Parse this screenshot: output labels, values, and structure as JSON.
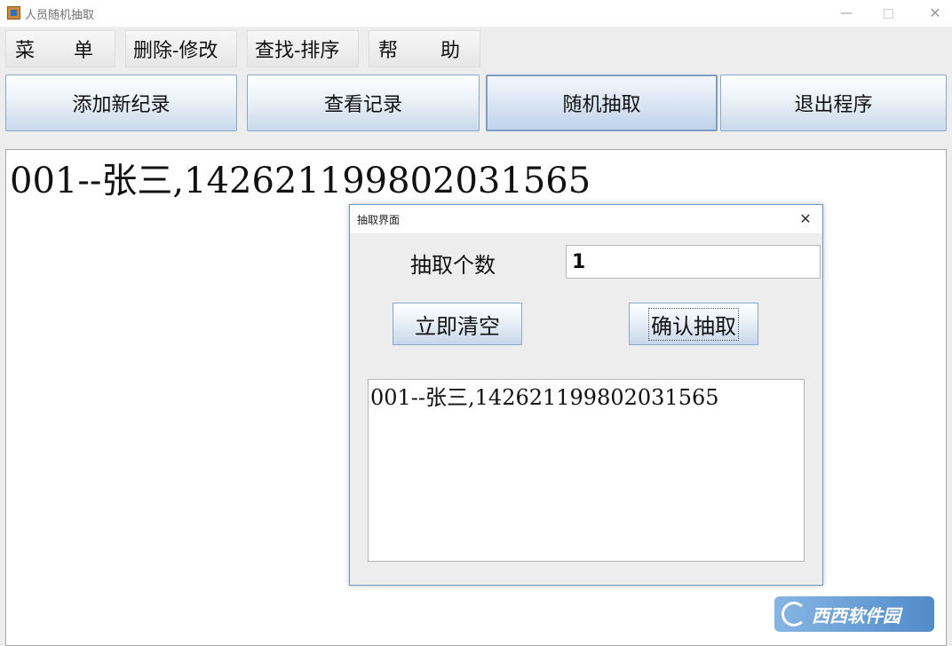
{
  "window": {
    "title": "人员随机抽取",
    "minimize": "—",
    "close": "✕"
  },
  "menu": {
    "items": [
      {
        "chars": [
          "菜",
          "单"
        ]
      },
      {
        "label": "删除-修改"
      },
      {
        "label": "查找-排序"
      },
      {
        "chars": [
          "帮",
          "助"
        ]
      }
    ]
  },
  "toolbar": {
    "add": "添加新纪录",
    "view": "查看记录",
    "random": "随机抽取",
    "exit": "退出程序"
  },
  "main": {
    "content": "001--张三,142621199802031565"
  },
  "dialog": {
    "title": "抽取界面",
    "close": "✕",
    "count_label": "抽取个数",
    "count_value": "1",
    "clear_button": "立即清空",
    "confirm_button": "确认抽取",
    "result": "001--张三,142621199802031565"
  },
  "watermark": {
    "text": "西西软件园"
  }
}
